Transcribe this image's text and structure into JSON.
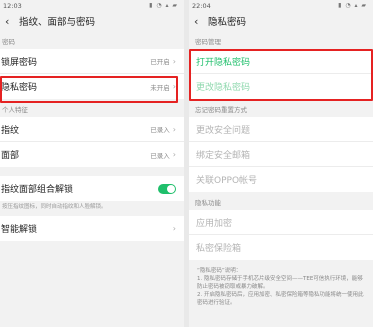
{
  "left": {
    "status_time": "12:03",
    "status_icons": "▮ ◔ ▴ ▰",
    "back_glyph": "‹",
    "title": "指纹、面部与密码",
    "section_password": "密码",
    "lock_screen_label": "锁屏密码",
    "lock_screen_value": "已开启",
    "privacy_label": "隐私密码",
    "privacy_value": "未开启",
    "section_personal": "个人特征",
    "fingerprint_label": "指纹",
    "fingerprint_value": "已录入",
    "face_label": "面部",
    "face_value": "已录入",
    "combo_label": "指纹面部组合解锁",
    "combo_hint": "按压指纹图标，同时自动指纹和人脸解锁。",
    "smart_unlock_label": "智能解锁"
  },
  "right": {
    "status_time": "22:04",
    "status_icons": "▮ ◔ ▴ ▰",
    "back_glyph": "‹",
    "title": "隐私密码",
    "section_manage": "密码管理",
    "open_label": "打开隐私密码",
    "change_label": "更改隐私密码",
    "section_reset": "忘记密码重置方式",
    "change_question_label": "更改安全问题",
    "bind_email_label": "绑定安全邮箱",
    "oppo_account_label": "关联OPPO帐号",
    "section_feature": "隐私功能",
    "app_encrypt_label": "应用加密",
    "safe_label": "私密保险箱",
    "notes": "“隐私密码”说明：\n1. 隐私密码存储于手机芯片级安全空间——TEE可信执行环境，能够防止密码被窃取或暴力破解。\n2. 开启隐私密码后，应用加密、私密保险箱等隐私功能将统一使用此密码进行验证。"
  },
  "colors": {
    "accent_green": "#1fbf6b",
    "highlight_red": "#e52222"
  }
}
